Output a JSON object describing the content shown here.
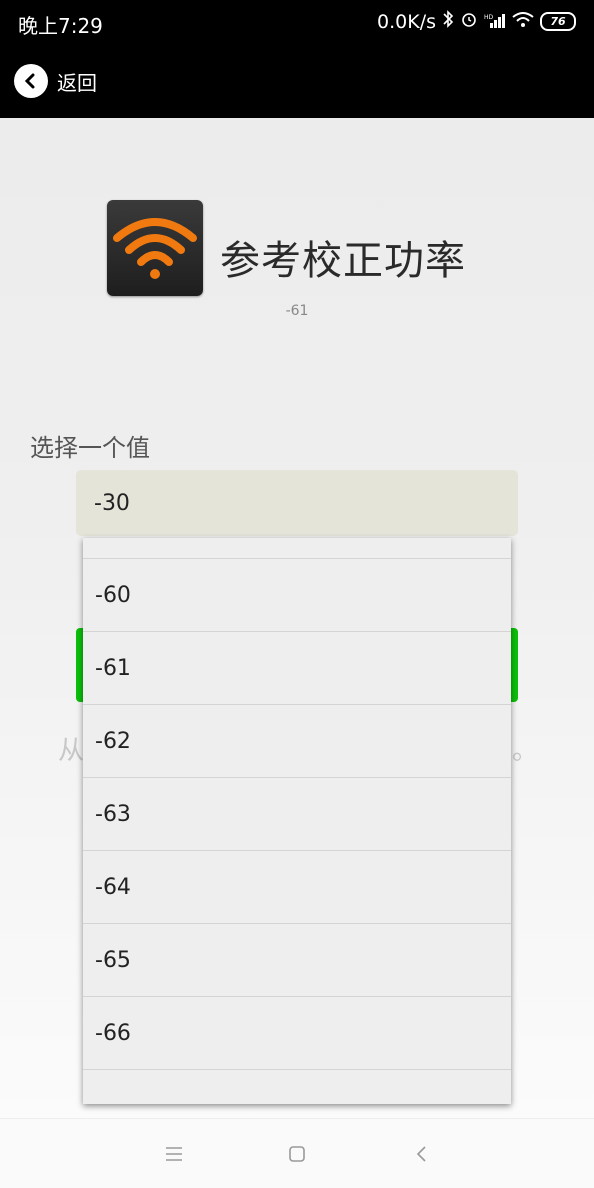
{
  "status_bar": {
    "time": "晚上7:29",
    "net_speed": "0.0K/s",
    "battery": "76"
  },
  "action_bar": {
    "back_label": "返回"
  },
  "header": {
    "title": "参考校正功率",
    "subtitle": "-61"
  },
  "select": {
    "label": "选择一个值",
    "current_value": "-30"
  },
  "dropdown": {
    "options": [
      "-60",
      "-61",
      "-62",
      "-63",
      "-64",
      "-65",
      "-66"
    ]
  },
  "background_text": {
    "left": "从",
    "right": "。"
  },
  "colors": {
    "accent_green": "#0cbf0c",
    "wifi_orange": "#f07a10"
  },
  "icons": {
    "app": "wifi-icon",
    "back": "chevron-left-icon",
    "nav_menu": "menu-icon",
    "nav_home": "home-icon",
    "nav_back": "back-icon"
  }
}
